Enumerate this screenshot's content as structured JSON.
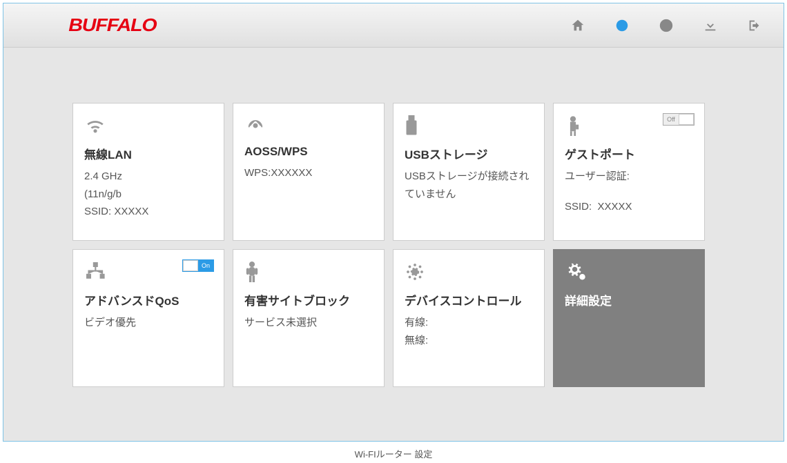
{
  "caption": "Wi-FIルーター 設定",
  "logo": "BUFFALO",
  "nav": {
    "home": "home",
    "status": "status",
    "info": "info",
    "download": "download",
    "logout": "logout"
  },
  "tiles": {
    "wlan": {
      "title": "無線LAN",
      "line1": "2.4 GHz",
      "line2": "(11n/g/b",
      "line3_label": "SSID:",
      "line3_value": "XXXXX"
    },
    "aoss": {
      "title": "AOSS/WPS",
      "line1_label": "WPS:",
      "line1_value": "XXXXXX"
    },
    "usb": {
      "title": "USBストレージ",
      "body": "USBストレージが接続されていません"
    },
    "guest": {
      "title": "ゲストポート",
      "toggle": "Off",
      "line1": "ユーザー認証:",
      "line2_label": "SSID:",
      "line2_value": "XXXXX"
    },
    "qos": {
      "title": "アドバンスドQoS",
      "toggle": "On",
      "body": "ビデオ優先"
    },
    "block": {
      "title": "有害サイトブロック",
      "body": "サービス未選択"
    },
    "device": {
      "title": "デバイスコントロール",
      "line1": "有線:",
      "line2": "無線:"
    },
    "advanced": {
      "title": "詳細設定"
    }
  }
}
